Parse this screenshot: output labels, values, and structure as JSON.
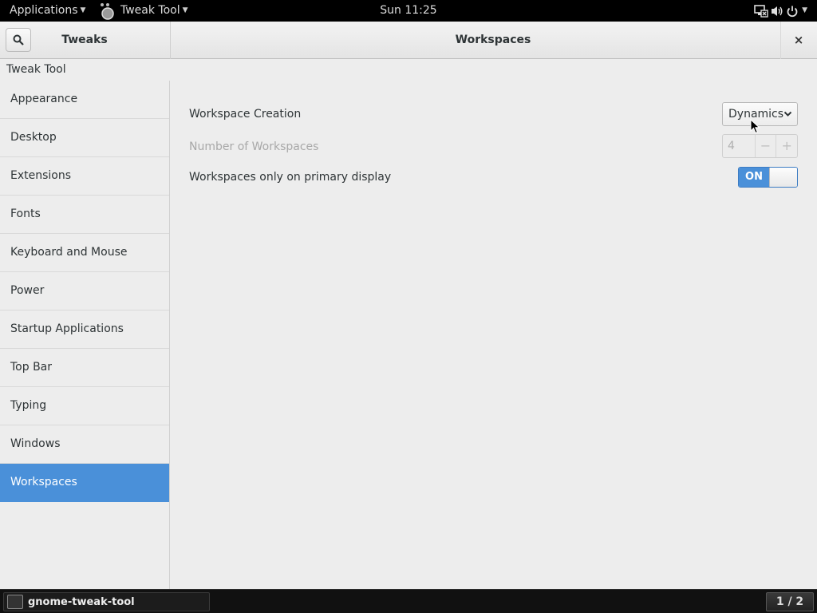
{
  "topbar": {
    "applications_label": "Applications",
    "app_menu_label": "Tweak Tool",
    "clock": "Sun 11:25"
  },
  "window": {
    "header_left_title": "Tweaks",
    "header_right_title": "Workspaces",
    "subtitle": "Tweak Tool",
    "close_label": "×"
  },
  "sidebar": {
    "items": [
      {
        "label": "Appearance"
      },
      {
        "label": "Desktop"
      },
      {
        "label": "Extensions"
      },
      {
        "label": "Fonts"
      },
      {
        "label": "Keyboard and Mouse"
      },
      {
        "label": "Power"
      },
      {
        "label": "Startup Applications"
      },
      {
        "label": "Top Bar"
      },
      {
        "label": "Typing"
      },
      {
        "label": "Windows"
      },
      {
        "label": "Workspaces"
      }
    ],
    "selected": "Workspaces"
  },
  "content": {
    "workspace_creation": {
      "label": "Workspace Creation",
      "value": "Dynamics"
    },
    "number_of_workspaces": {
      "label": "Number of Workspaces",
      "value": "4",
      "decrement": "−",
      "increment": "+",
      "enabled": false
    },
    "primary_display_only": {
      "label": "Workspaces only on primary display",
      "state": "ON"
    }
  },
  "bottombar": {
    "task_label": "gnome-tweak-tool",
    "workspace_indicator": "1 / 2"
  },
  "colors": {
    "accent": "#4a90d9",
    "topbar_bg": "#000000",
    "window_bg": "#ededed"
  }
}
